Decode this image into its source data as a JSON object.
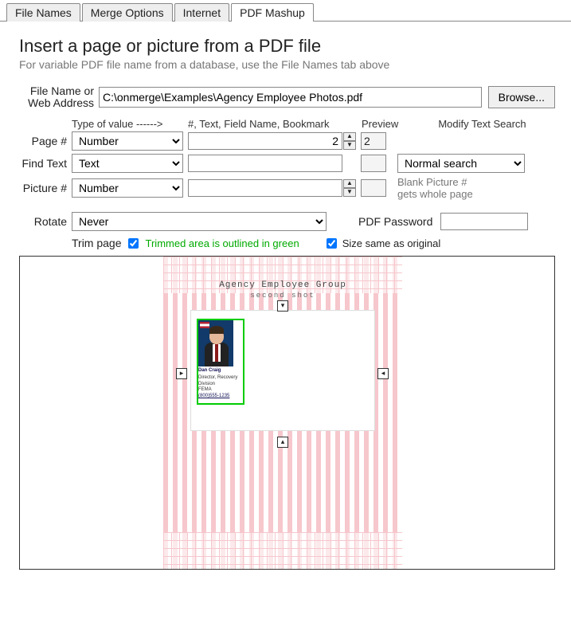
{
  "tabs": [
    "File Names",
    "Merge Options",
    "Internet",
    "PDF Mashup"
  ],
  "activeTab": 3,
  "title": "Insert a page or picture from a PDF file",
  "subtitle": "For variable PDF file name from a database, use the File Names tab above",
  "fileRow": {
    "label1": "File Name or",
    "label2": "Web Address",
    "value": "C:\\onmerge\\Examples\\Agency Employee Photos.pdf",
    "browse": "Browse..."
  },
  "headers": {
    "typeOfValue": "Type of value ------>",
    "numText": "#, Text, Field Name, Bookmark",
    "preview": "Preview",
    "modify": "Modify Text Search"
  },
  "rows": {
    "page": {
      "label": "Page #",
      "type": "Number",
      "value": "2",
      "preview": "2"
    },
    "find": {
      "label": "Find Text",
      "type": "Text",
      "value": "",
      "preview": ""
    },
    "picture": {
      "label": "Picture #",
      "type": "Number",
      "value": "",
      "preview": ""
    }
  },
  "modifySearch": {
    "value": "Normal search"
  },
  "pictureHint1": "Blank Picture #",
  "pictureHint2": "gets whole page",
  "rotate": {
    "label": "Rotate",
    "value": "Never"
  },
  "password": {
    "label": "PDF Password",
    "value": ""
  },
  "trim": {
    "label": "Trim page",
    "checked": true,
    "note": "Trimmed area is outlined in green"
  },
  "sizeSame": {
    "label": "Size same as original",
    "checked": true
  },
  "docTitle": "Agency Employee Group",
  "docSub": "second shot",
  "card": {
    "name": "Dan Craig",
    "role": "Director, Recovery Division",
    "org": "FEMA",
    "phone": "(800)555-1235"
  }
}
